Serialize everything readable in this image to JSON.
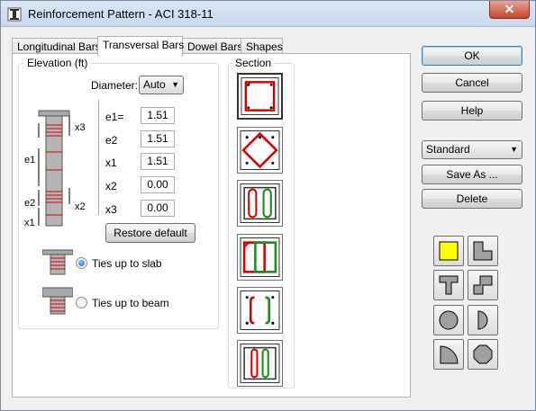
{
  "window": {
    "title": "Reinforcement Pattern - ACI 318-11",
    "close_symbol": "✕"
  },
  "tabs": [
    {
      "label": "Longitudinal Bars"
    },
    {
      "label": "Transversal Bars"
    },
    {
      "label": "Dowel Bars"
    },
    {
      "label": "Shapes"
    }
  ],
  "elevation": {
    "group_label": "Elevation (ft)",
    "diameter_label": "Diameter:",
    "diameter_value": "Auto",
    "diagram_labels": {
      "e1": "e1",
      "e2": "e2",
      "x1": "x1",
      "x2": "x2",
      "x3": "x3"
    },
    "params": [
      {
        "label": "e1=",
        "value": "1.51"
      },
      {
        "label": "e2",
        "value": "1.51"
      },
      {
        "label": "x1",
        "value": "1.51"
      },
      {
        "label": "x2",
        "value": "0.00"
      },
      {
        "label": "x3",
        "value": "0.00"
      }
    ],
    "restore_label": "Restore default",
    "ties_slab_label": "Ties up to slab",
    "ties_beam_label": "Ties up to beam",
    "ties_selected": "slab"
  },
  "section": {
    "group_label": "Section",
    "patterns": [
      "square-tie",
      "diamond-tie",
      "double-hook-ties",
      "overlapping-ties",
      "crossties-hooks",
      "crossties-interior"
    ]
  },
  "buttons": {
    "ok": "OK",
    "cancel": "Cancel",
    "help": "Help",
    "save_as": "Save As ...",
    "delete": "Delete"
  },
  "preset": {
    "value": "Standard"
  },
  "shapes": [
    "square",
    "l-shape",
    "t-shape",
    "z-shape",
    "circle",
    "half-circle",
    "quarter-circle",
    "octagon"
  ],
  "colors": {
    "tie_red": "#d40000",
    "tie_green": "#1a8a1a",
    "shape_selected": "#ffff00",
    "shape_fill": "#a0a0a0"
  }
}
